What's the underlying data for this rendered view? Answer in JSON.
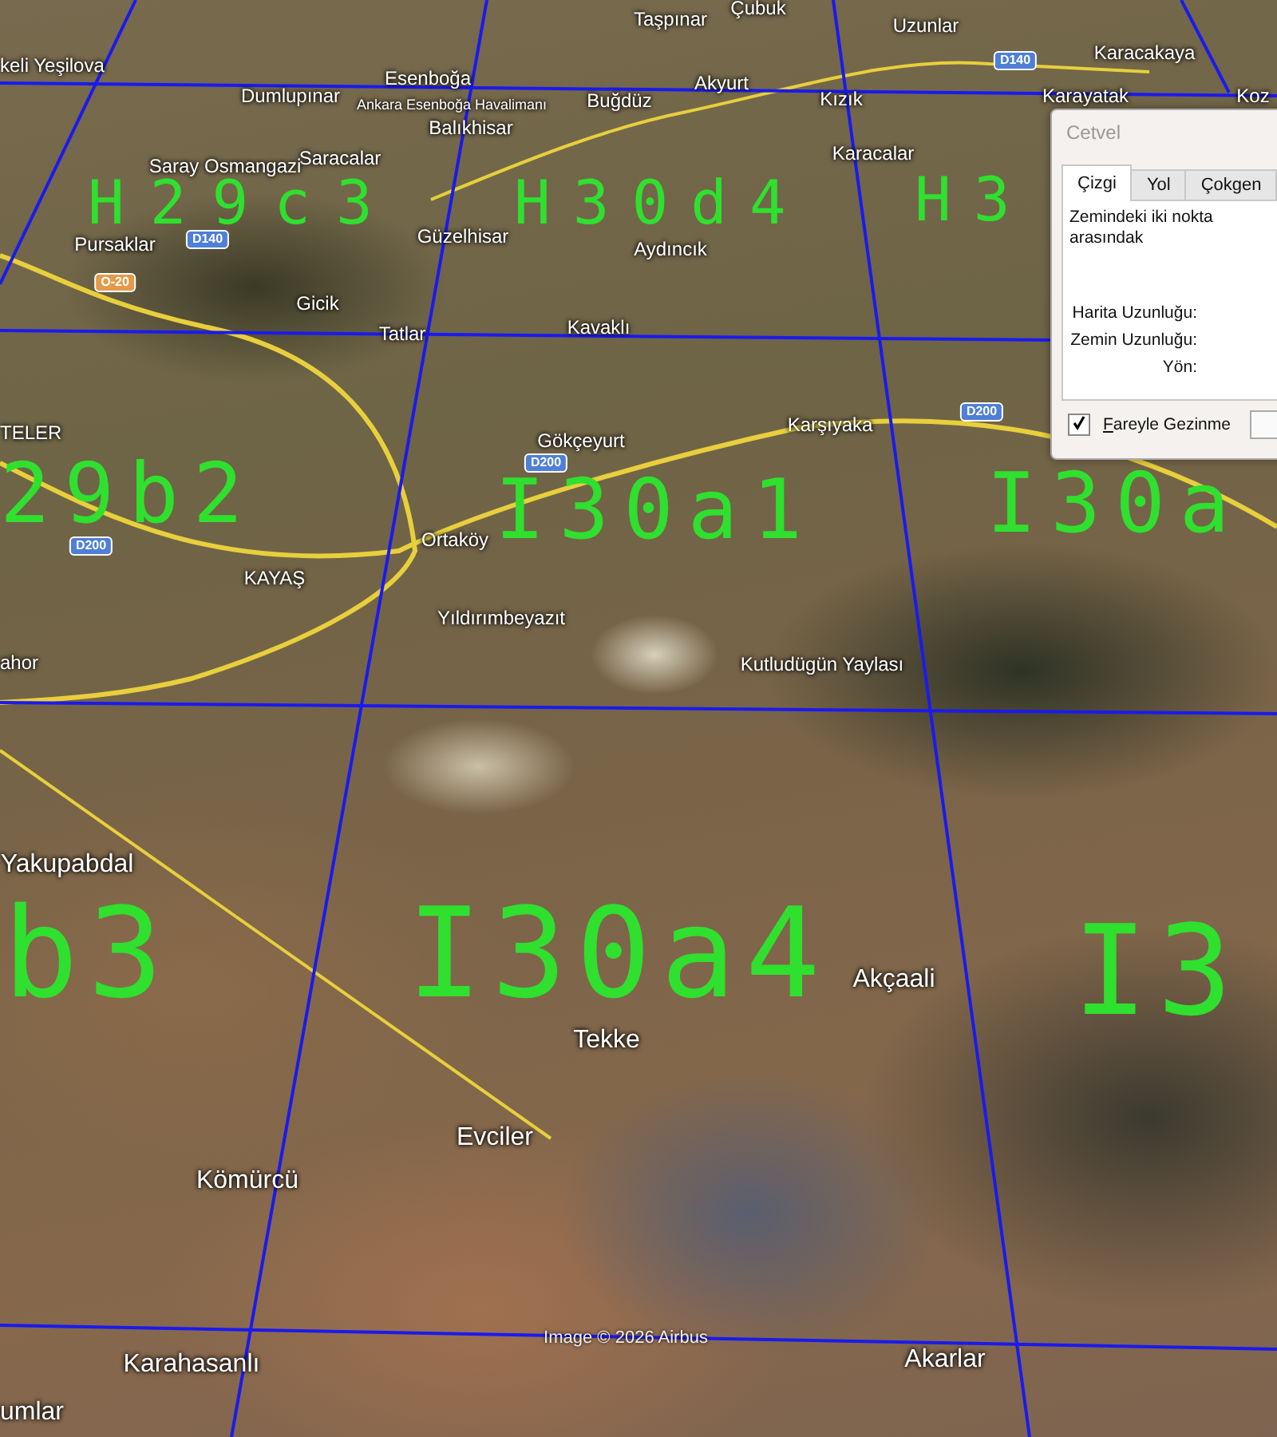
{
  "map": {
    "places": [
      {
        "name": "keli Yeşilova",
        "kind": "minor"
      },
      {
        "name": "Çubuk",
        "kind": "minor"
      },
      {
        "name": "Taşpınar",
        "kind": "minor"
      },
      {
        "name": "Uzunlar",
        "kind": "minor"
      },
      {
        "name": "Karacakaya",
        "kind": "minor"
      },
      {
        "name": "Esenboğa",
        "kind": "minor"
      },
      {
        "name": "Akyurt",
        "kind": "minor"
      },
      {
        "name": "Dumlupınar",
        "kind": "minor"
      },
      {
        "name": "Ankara Esenboğa Havalimanı",
        "kind": "small"
      },
      {
        "name": "Buğdüz",
        "kind": "minor"
      },
      {
        "name": "Kızık",
        "kind": "minor"
      },
      {
        "name": "Karayatak",
        "kind": "minor"
      },
      {
        "name": "Koz",
        "kind": "minor"
      },
      {
        "name": "Balıkhisar",
        "kind": "minor"
      },
      {
        "name": "Karacalar",
        "kind": "minor"
      },
      {
        "name": "Saracalar",
        "kind": "minor"
      },
      {
        "name": "Saray Osmangazi",
        "kind": "minor"
      },
      {
        "name": "Güzelhisar",
        "kind": "minor"
      },
      {
        "name": "Pursaklar",
        "kind": "minor"
      },
      {
        "name": "Aydıncık",
        "kind": "minor"
      },
      {
        "name": "Gicik",
        "kind": "minor"
      },
      {
        "name": "Tatlar",
        "kind": "minor"
      },
      {
        "name": "Kavaklı",
        "kind": "minor"
      },
      {
        "name": "Karşıyaka",
        "kind": "minor"
      },
      {
        "name": "TELER",
        "kind": "minor"
      },
      {
        "name": "Gökçeyurt",
        "kind": "minor"
      },
      {
        "name": "Ortaköy",
        "kind": "minor"
      },
      {
        "name": "KAYAŞ",
        "kind": "minor"
      },
      {
        "name": "Yıldırımbeyazıt",
        "kind": "minor"
      },
      {
        "name": "ahor",
        "kind": "minor"
      },
      {
        "name": "Kutludügün Yaylası",
        "kind": "minor"
      },
      {
        "name": "Yakupabdal",
        "kind": "major"
      },
      {
        "name": "Akçaali",
        "kind": "major"
      },
      {
        "name": "Tekke",
        "kind": "major"
      },
      {
        "name": "Evciler",
        "kind": "major"
      },
      {
        "name": "Kömürcü",
        "kind": "major"
      },
      {
        "name": "Karahasanlı",
        "kind": "major"
      },
      {
        "name": "Akarlar",
        "kind": "major"
      },
      {
        "name": "umlar",
        "kind": "major"
      }
    ],
    "road_shields": [
      {
        "label": "D140",
        "color": "#4f7fd6"
      },
      {
        "label": "D140",
        "color": "#4f7fd6"
      },
      {
        "label": "O-20",
        "color": "#e39a4a"
      },
      {
        "label": "D200",
        "color": "#4f7fd6"
      },
      {
        "label": "D200",
        "color": "#4f7fd6"
      },
      {
        "label": "D200",
        "color": "#4f7fd6"
      }
    ],
    "grid_labels": [
      "H29c3",
      "H30d4",
      "H3",
      "29b2",
      "I30a1",
      "I30a",
      "b3",
      "I30a4",
      "I3"
    ],
    "attribution": "Image © 2026 Airbus"
  },
  "ruler_dialog": {
    "title": "Cetvel",
    "tabs": [
      {
        "label": "Çizgi",
        "selected": true
      },
      {
        "label": "Yol",
        "selected": false
      },
      {
        "label": "Çokgen",
        "selected": false
      }
    ],
    "description": "Zemindeki iki nokta arasındak",
    "fields": [
      "Harita Uzunluğu:",
      "Zemin Uzunluğu:",
      "Yön:"
    ],
    "mouse_navigation": {
      "label": "Fareyle Gezinme",
      "checked": true
    }
  }
}
